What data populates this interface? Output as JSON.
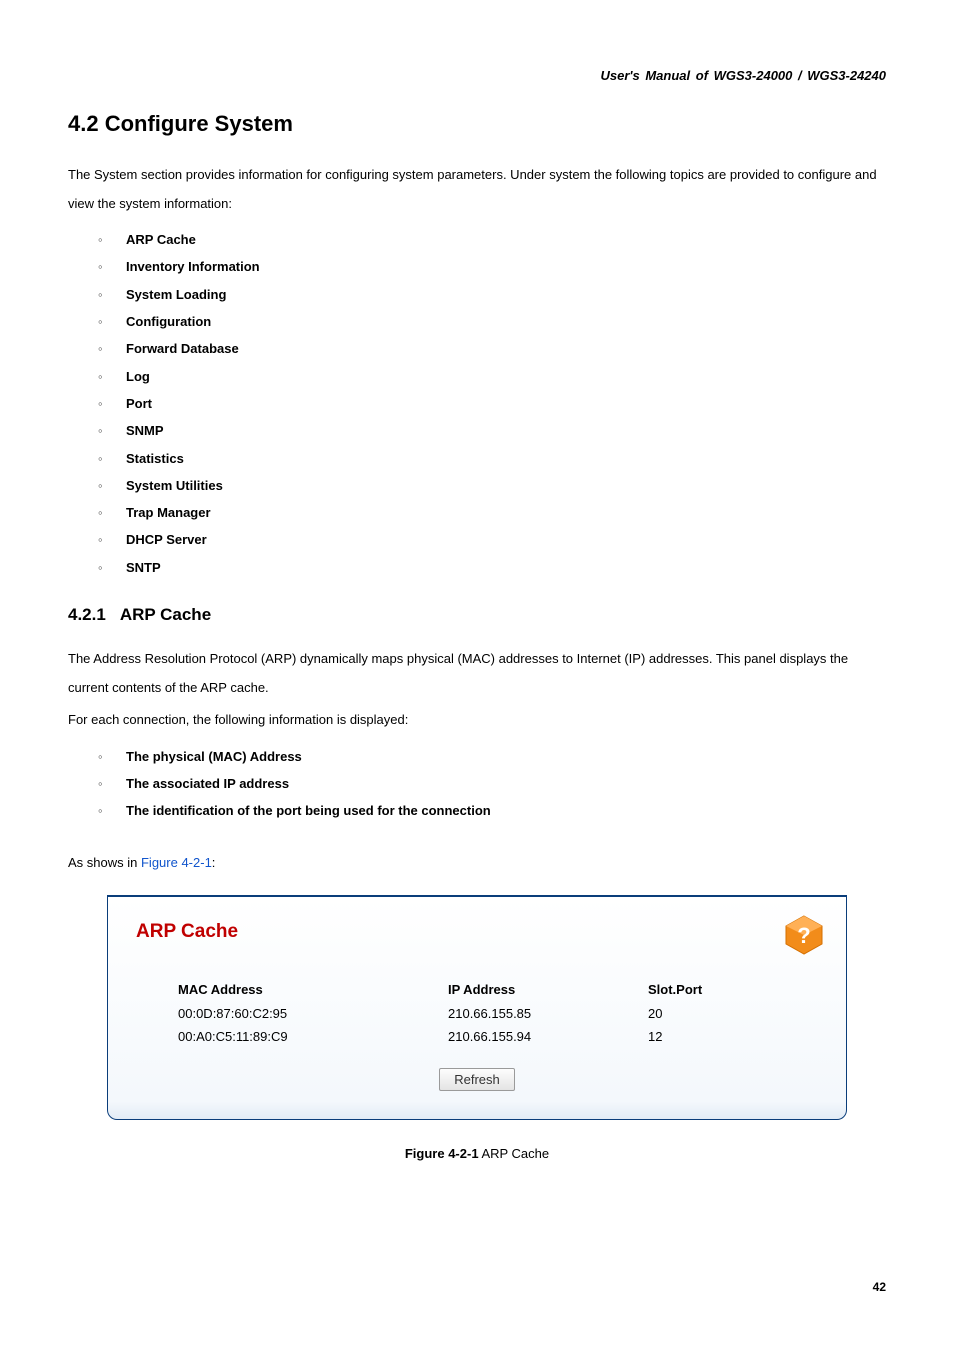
{
  "header": "User's Manual of WGS3-24000 / WGS3-24240",
  "section_heading": "4.2 Configure System",
  "intro_text": "The System section provides information for configuring system parameters. Under system the following topics are provided to configure and view the system information:",
  "topics": [
    "ARP Cache",
    "Inventory Information",
    "System Loading",
    "Configuration",
    "Forward Database",
    "Log",
    "Port",
    "SNMP",
    "Statistics",
    "System Utilities",
    "Trap Manager",
    "DHCP Server",
    "SNTP"
  ],
  "subsection_number": "4.2.1",
  "subsection_title": "ARP Cache",
  "arp_intro": "The Address Resolution Protocol (ARP) dynamically maps physical (MAC) addresses to Internet (IP) addresses. This panel displays the current contents of the ARP cache.",
  "arp_each_text": "For each connection, the following information is displayed:",
  "arp_fields": [
    "The physical (MAC) Address",
    "The associated IP address",
    "The identification of the port being used for the connection"
  ],
  "as_shows_prefix": "As shows in ",
  "as_shows_link": "Figure 4-2-1",
  "as_shows_suffix": ":",
  "panel": {
    "title": "ARP Cache",
    "columns": {
      "mac": "MAC Address",
      "ip": "IP Address",
      "slot": "Slot.Port"
    },
    "rows": [
      {
        "mac": "00:0D:87:60:C2:95",
        "ip": "210.66.155.85",
        "slot": "20"
      },
      {
        "mac": "00:A0:C5:11:89:C9",
        "ip": "210.66.155.94",
        "slot": "12"
      }
    ],
    "refresh_label": "Refresh"
  },
  "figure_caption_bold": "Figure 4-2-1",
  "figure_caption_rest": " ARP Cache",
  "page_number": "42"
}
